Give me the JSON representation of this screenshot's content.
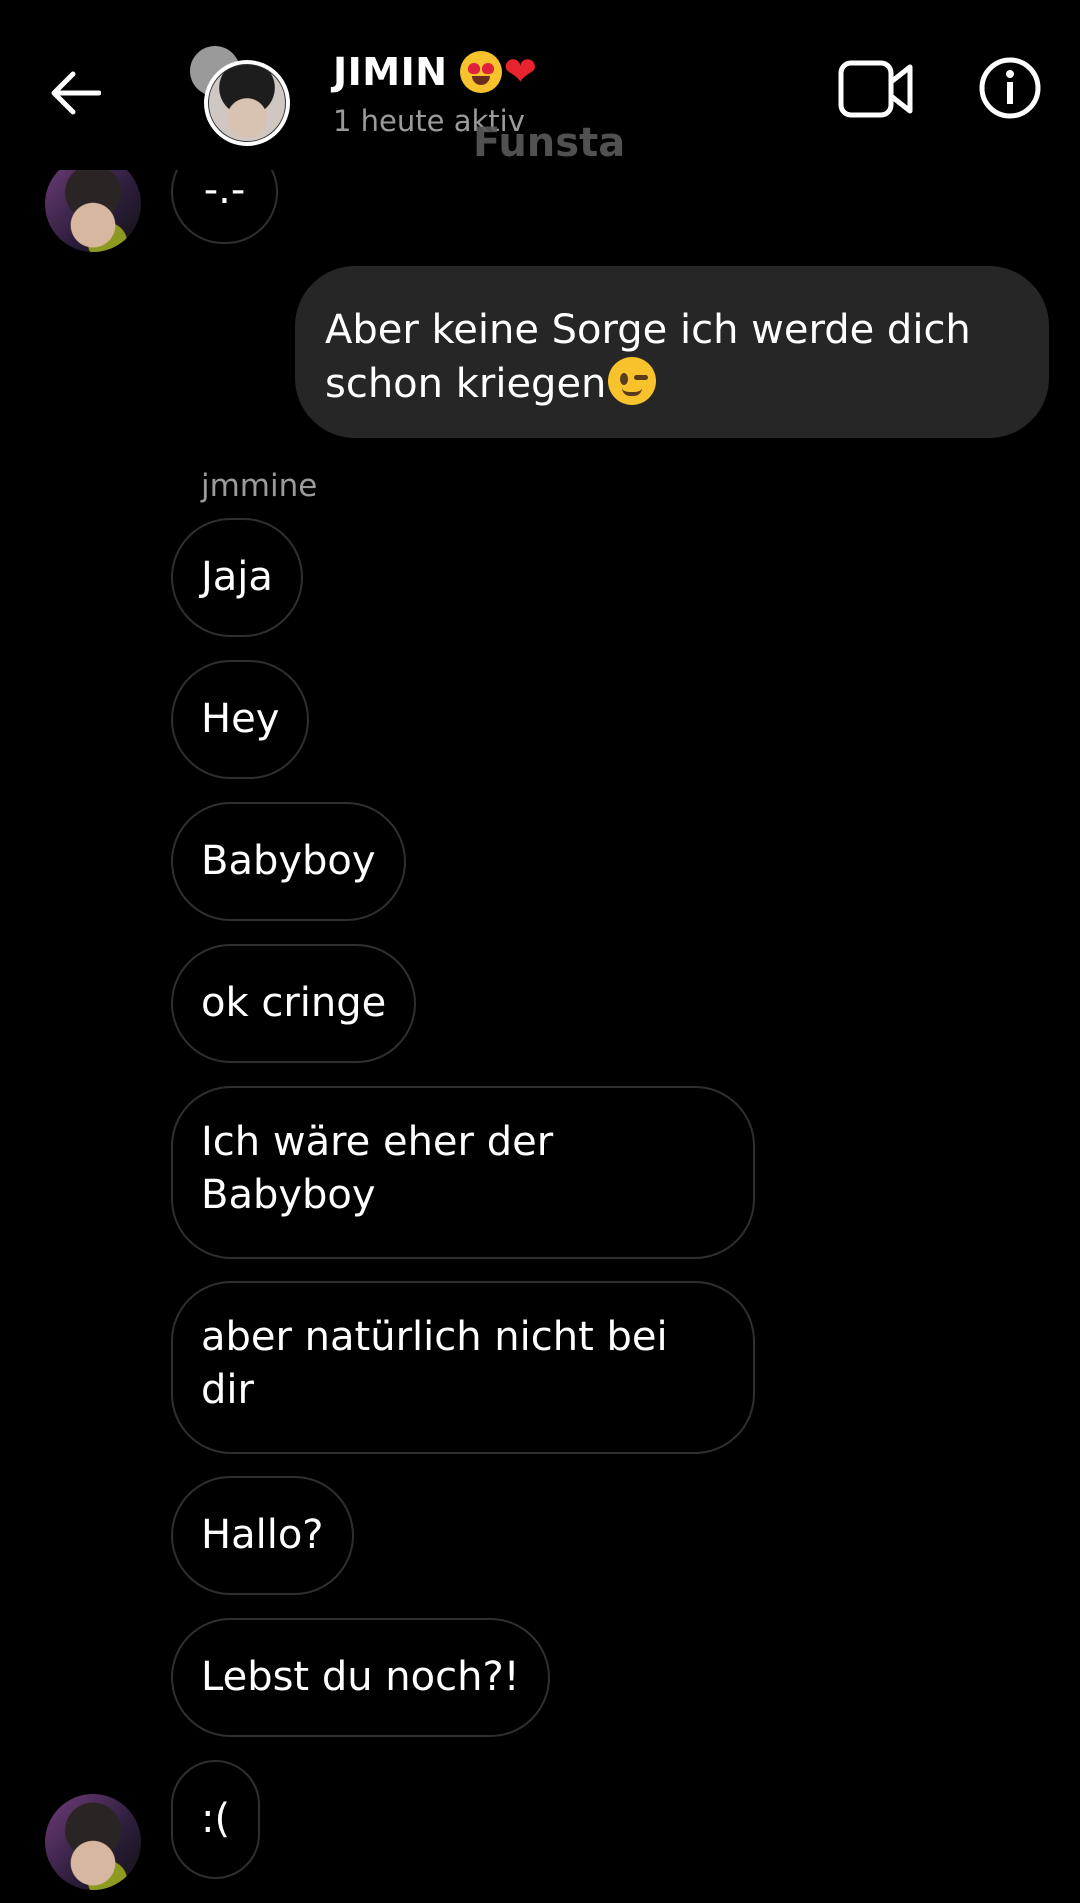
{
  "header": {
    "title": "JIMIN",
    "status": "1 heute aktiv",
    "watermark": "Funsta",
    "heart_symbol": "❤"
  },
  "messages": {
    "received_top": "-.-",
    "sent_1_text": "Aber keine Sorge ich werde dich schon kriegen",
    "sender_name": "jmmine",
    "received": [
      "Jaja",
      "Hey",
      "Babyboy",
      "ok cringe",
      "Ich wäre eher der Babyboy",
      "aber natürlich nicht bei dir",
      "Hallo?",
      "Lebst du noch?!",
      ":("
    ]
  },
  "icons": {
    "back": "arrow-left-icon",
    "video": "video-camera-icon",
    "info": "info-icon",
    "emoji_title": "heart-eyes-emoji",
    "emoji_sent": "winking-face-emoji"
  }
}
